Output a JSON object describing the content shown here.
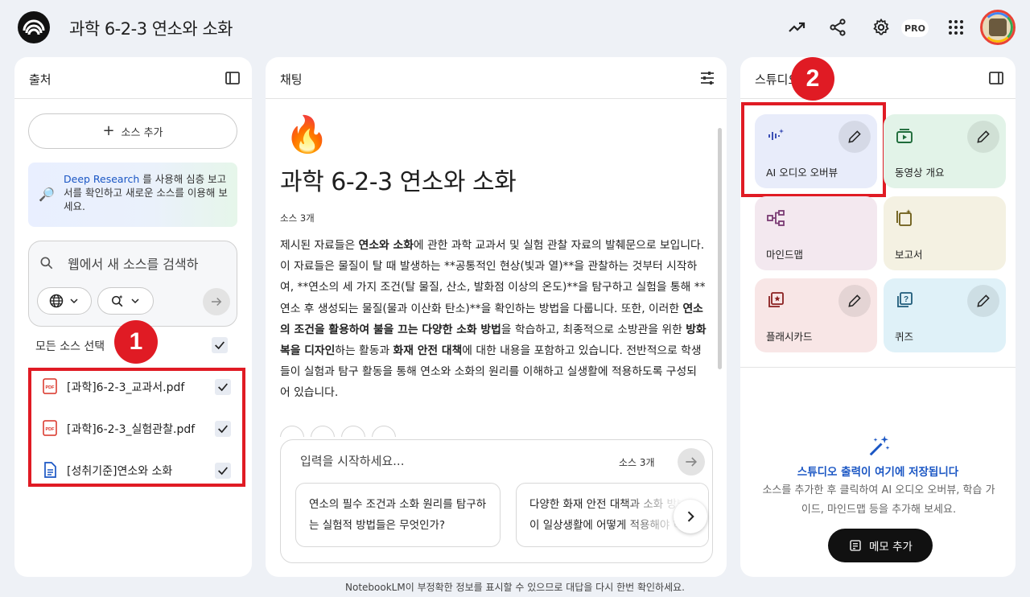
{
  "header": {
    "title": "과학 6-2-3 연소와 소화",
    "pro_badge": "PRO",
    "icons": [
      "analytics-icon",
      "share-icon",
      "settings-icon",
      "apps-grid-icon"
    ]
  },
  "sources_panel": {
    "title": "출처",
    "add_source_label": "소스 추가",
    "deep_research": {
      "link": "Deep Research",
      "text": " 를 사용해 심층 보고서를 확인하고 새로운 소스를 이용해 보세요."
    },
    "search_placeholder": "웹에서 새 소스를 검색하",
    "select_all_label": "모든 소스 선택",
    "items": [
      {
        "name": "[과학]6-2-3_교과서.pdf",
        "type": "pdf",
        "checked": true
      },
      {
        "name": "[과학]6-2-3_실험관찰.pdf",
        "type": "pdf",
        "checked": true
      },
      {
        "name": "[성취기준]연소와 소화",
        "type": "doc",
        "checked": true
      }
    ],
    "callout": "1"
  },
  "chat_panel": {
    "title": "채팅",
    "emoji": "🔥",
    "notebook_title": "과학 6-2-3 연소와 소화",
    "source_count": "소스 3개",
    "summary": {
      "p1": "제시된 자료들은 ",
      "b1": "연소와 소화",
      "p2": "에 관한 과학 교과서 및 실험 관찰 자료의 발췌문으로 보입니다. 이 자료들은 물질이 탈 때 발생하는 **공통적인 현상(빛과 열)**을 관찰하는 것부터 시작하여, **연소의 세 가지 조건(탈 물질, 산소, 발화점 이상의 온도)**을 탐구하고 실험을 통해 **연소 후 생성되는 물질(물과 이산화 탄소)**을 확인하는 방법을 다룹니다. 또한, 이러한 ",
      "b2": "연소의 조건을 활용하여 불을 끄는 다양한 소화 방법",
      "p3": "을 학습하고, 최종적으로 소방관을 위한 ",
      "b3": "방화복을 디자인",
      "p4": "하는 활동과 ",
      "b4": "화재 안전 대책",
      "p5": "에 대한 내용을 포함하고 있습니다. 전반적으로 학생들이 실험과 탐구 활동을 통해 연소와 소화의 원리를 이해하고 실생활에 적용하도록 구성되어 있습니다."
    },
    "composer": {
      "placeholder": "입력을 시작하세요...",
      "source_count": "소스 3개"
    },
    "suggestions": [
      "연소의 필수 조건과 소화 원리를 탐구하는 실험적 방법들은 무엇인가?",
      "다양한 화재 안전 대책과 소화 방법이 일상생활에 어떻게 적용해야 하"
    ]
  },
  "studio_panel": {
    "title": "스튜디오",
    "callout": "2",
    "cards": {
      "audio": "AI 오디오 오버뷰",
      "video": "동영상 개요",
      "mindmap": "마인드맵",
      "report": "보고서",
      "flashcards": "플래시카드",
      "quiz": "퀴즈"
    },
    "empty_title": "스튜디오 출력이 여기에 저장됩니다",
    "empty_desc": "소스를 추가한 후 클릭하여 AI 오디오 오버뷰, 학습 가이드, 마인드맵 등을 추가해 보세요.",
    "memo_button": "메모 추가"
  },
  "footer": "NotebookLM이 부정확한 정보를 표시할 수 있으므로 대답을 다시 한번 확인하세요.",
  "colors": {
    "accent_red": "#e01b24",
    "link_blue": "#1a56c4",
    "background": "#eef1f6"
  }
}
